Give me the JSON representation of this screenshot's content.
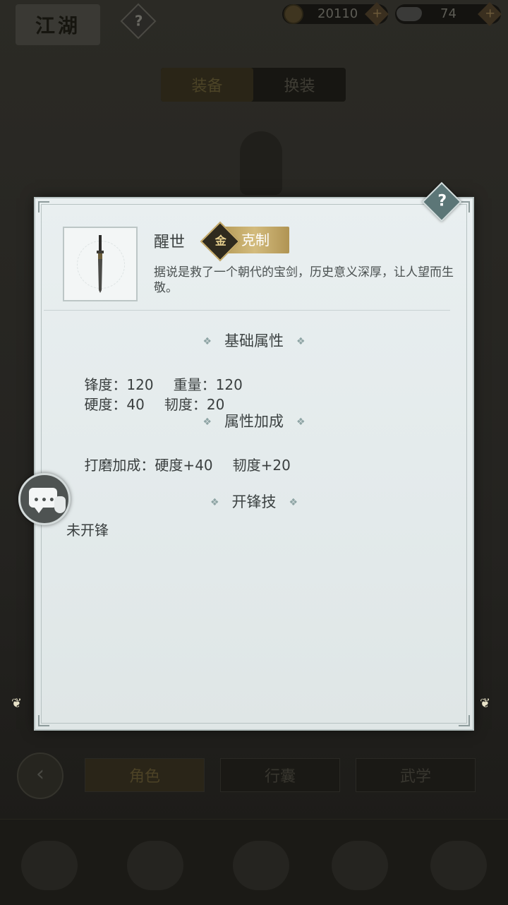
{
  "background": {
    "title": "江湖",
    "help_symbol": "?",
    "currency": [
      {
        "icon": "coin-icon",
        "value": "20110"
      },
      {
        "icon": "silver-ingot-icon",
        "value": "74"
      }
    ],
    "plus_symbol": "+",
    "top_tabs": [
      {
        "label": "装备"
      },
      {
        "label": "换装"
      }
    ],
    "bottom_tabs": [
      {
        "label": "角色"
      },
      {
        "label": "行囊"
      },
      {
        "label": "武学"
      }
    ],
    "back_symbol": "‹"
  },
  "popup": {
    "help_symbol": "?",
    "item": {
      "name": "醒世",
      "badge_icon_text": "金",
      "badge_label": "克制",
      "description": "据说是救了一个朝代的宝剑，历史意义深厚，让人望而生敬。"
    },
    "sections": {
      "base_title": "基础属性",
      "base_stats_line1": [
        "锋度：120",
        "重量：120"
      ],
      "base_stats_line2": [
        "硬度：40",
        "韧度：20"
      ],
      "bonus_title": "属性加成",
      "bonus_line": [
        "打磨加成：硬度+40",
        "韧度+20"
      ],
      "edge_title": "开锋技",
      "edge_value": "未开锋"
    },
    "ornament": "❖"
  },
  "colors": {
    "popup_bg": "#e6eced",
    "badge_gold": "#c4a967",
    "help_teal": "#5c7677"
  }
}
